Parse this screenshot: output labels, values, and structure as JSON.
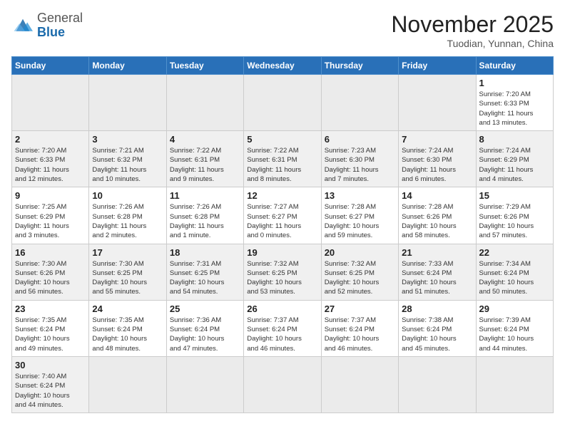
{
  "header": {
    "logo_line1": "General",
    "logo_line2": "Blue",
    "month": "November 2025",
    "location": "Tuodian, Yunnan, China"
  },
  "weekdays": [
    "Sunday",
    "Monday",
    "Tuesday",
    "Wednesday",
    "Thursday",
    "Friday",
    "Saturday"
  ],
  "weeks": [
    [
      {
        "day": "",
        "info": ""
      },
      {
        "day": "",
        "info": ""
      },
      {
        "day": "",
        "info": ""
      },
      {
        "day": "",
        "info": ""
      },
      {
        "day": "",
        "info": ""
      },
      {
        "day": "",
        "info": ""
      },
      {
        "day": "1",
        "info": "Sunrise: 7:20 AM\nSunset: 6:33 PM\nDaylight: 11 hours\nand 13 minutes."
      }
    ],
    [
      {
        "day": "2",
        "info": "Sunrise: 7:20 AM\nSunset: 6:33 PM\nDaylight: 11 hours\nand 12 minutes."
      },
      {
        "day": "3",
        "info": "Sunrise: 7:21 AM\nSunset: 6:32 PM\nDaylight: 11 hours\nand 10 minutes."
      },
      {
        "day": "4",
        "info": "Sunrise: 7:22 AM\nSunset: 6:31 PM\nDaylight: 11 hours\nand 9 minutes."
      },
      {
        "day": "5",
        "info": "Sunrise: 7:22 AM\nSunset: 6:31 PM\nDaylight: 11 hours\nand 8 minutes."
      },
      {
        "day": "6",
        "info": "Sunrise: 7:23 AM\nSunset: 6:30 PM\nDaylight: 11 hours\nand 7 minutes."
      },
      {
        "day": "7",
        "info": "Sunrise: 7:24 AM\nSunset: 6:30 PM\nDaylight: 11 hours\nand 6 minutes."
      },
      {
        "day": "8",
        "info": "Sunrise: 7:24 AM\nSunset: 6:29 PM\nDaylight: 11 hours\nand 4 minutes."
      }
    ],
    [
      {
        "day": "9",
        "info": "Sunrise: 7:25 AM\nSunset: 6:29 PM\nDaylight: 11 hours\nand 3 minutes."
      },
      {
        "day": "10",
        "info": "Sunrise: 7:26 AM\nSunset: 6:28 PM\nDaylight: 11 hours\nand 2 minutes."
      },
      {
        "day": "11",
        "info": "Sunrise: 7:26 AM\nSunset: 6:28 PM\nDaylight: 11 hours\nand 1 minute."
      },
      {
        "day": "12",
        "info": "Sunrise: 7:27 AM\nSunset: 6:27 PM\nDaylight: 11 hours\nand 0 minutes."
      },
      {
        "day": "13",
        "info": "Sunrise: 7:28 AM\nSunset: 6:27 PM\nDaylight: 10 hours\nand 59 minutes."
      },
      {
        "day": "14",
        "info": "Sunrise: 7:28 AM\nSunset: 6:26 PM\nDaylight: 10 hours\nand 58 minutes."
      },
      {
        "day": "15",
        "info": "Sunrise: 7:29 AM\nSunset: 6:26 PM\nDaylight: 10 hours\nand 57 minutes."
      }
    ],
    [
      {
        "day": "16",
        "info": "Sunrise: 7:30 AM\nSunset: 6:26 PM\nDaylight: 10 hours\nand 56 minutes."
      },
      {
        "day": "17",
        "info": "Sunrise: 7:30 AM\nSunset: 6:25 PM\nDaylight: 10 hours\nand 55 minutes."
      },
      {
        "day": "18",
        "info": "Sunrise: 7:31 AM\nSunset: 6:25 PM\nDaylight: 10 hours\nand 54 minutes."
      },
      {
        "day": "19",
        "info": "Sunrise: 7:32 AM\nSunset: 6:25 PM\nDaylight: 10 hours\nand 53 minutes."
      },
      {
        "day": "20",
        "info": "Sunrise: 7:32 AM\nSunset: 6:25 PM\nDaylight: 10 hours\nand 52 minutes."
      },
      {
        "day": "21",
        "info": "Sunrise: 7:33 AM\nSunset: 6:24 PM\nDaylight: 10 hours\nand 51 minutes."
      },
      {
        "day": "22",
        "info": "Sunrise: 7:34 AM\nSunset: 6:24 PM\nDaylight: 10 hours\nand 50 minutes."
      }
    ],
    [
      {
        "day": "23",
        "info": "Sunrise: 7:35 AM\nSunset: 6:24 PM\nDaylight: 10 hours\nand 49 minutes."
      },
      {
        "day": "24",
        "info": "Sunrise: 7:35 AM\nSunset: 6:24 PM\nDaylight: 10 hours\nand 48 minutes."
      },
      {
        "day": "25",
        "info": "Sunrise: 7:36 AM\nSunset: 6:24 PM\nDaylight: 10 hours\nand 47 minutes."
      },
      {
        "day": "26",
        "info": "Sunrise: 7:37 AM\nSunset: 6:24 PM\nDaylight: 10 hours\nand 46 minutes."
      },
      {
        "day": "27",
        "info": "Sunrise: 7:37 AM\nSunset: 6:24 PM\nDaylight: 10 hours\nand 46 minutes."
      },
      {
        "day": "28",
        "info": "Sunrise: 7:38 AM\nSunset: 6:24 PM\nDaylight: 10 hours\nand 45 minutes."
      },
      {
        "day": "29",
        "info": "Sunrise: 7:39 AM\nSunset: 6:24 PM\nDaylight: 10 hours\nand 44 minutes."
      }
    ],
    [
      {
        "day": "30",
        "info": "Sunrise: 7:40 AM\nSunset: 6:24 PM\nDaylight: 10 hours\nand 44 minutes."
      },
      {
        "day": "",
        "info": ""
      },
      {
        "day": "",
        "info": ""
      },
      {
        "day": "",
        "info": ""
      },
      {
        "day": "",
        "info": ""
      },
      {
        "day": "",
        "info": ""
      },
      {
        "day": "",
        "info": ""
      }
    ]
  ]
}
